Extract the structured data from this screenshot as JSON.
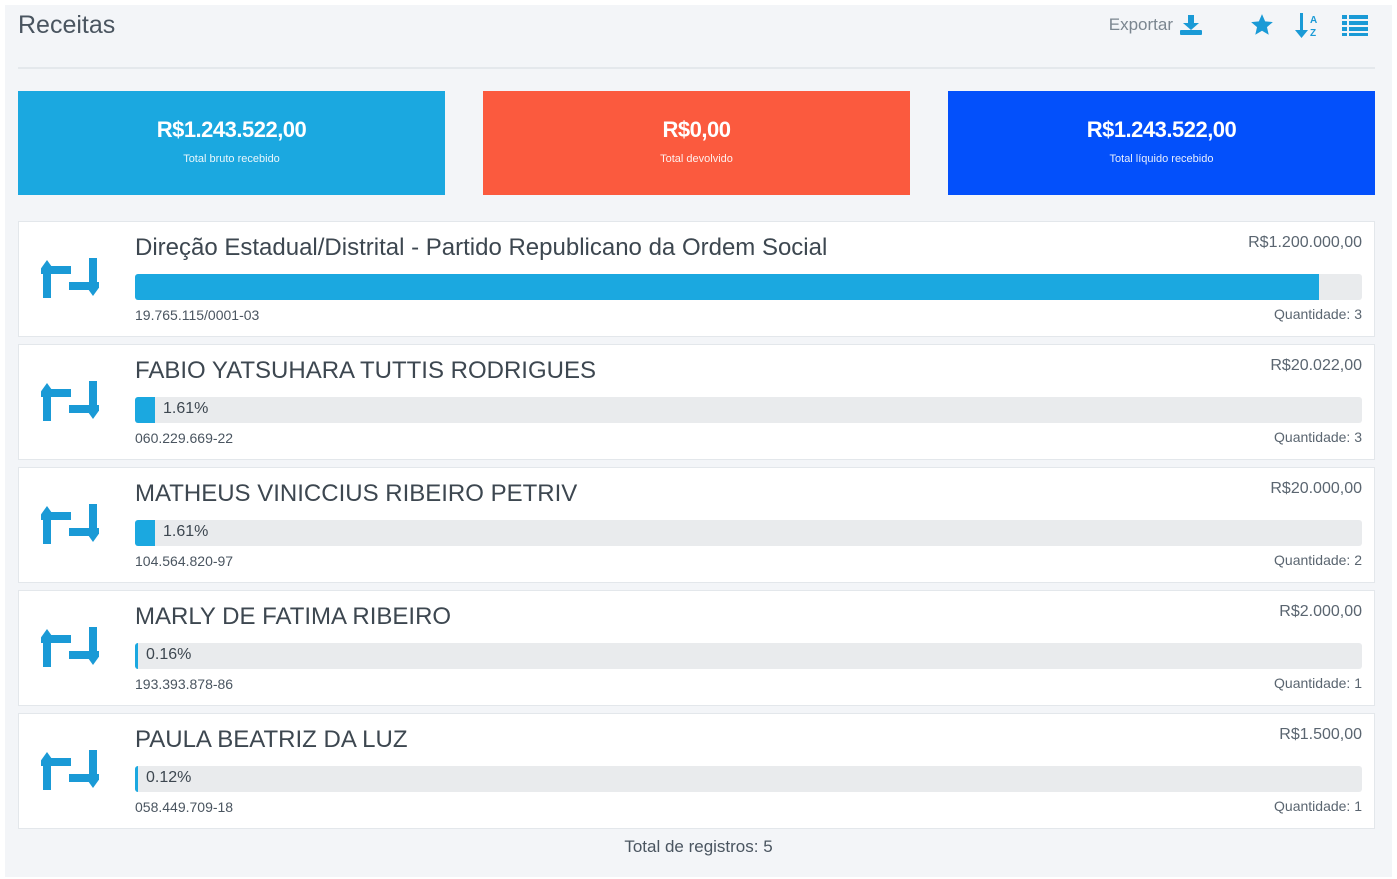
{
  "header": {
    "title": "Receitas",
    "export_label": "Exportar",
    "icons": [
      "download-icon",
      "star-icon",
      "sort-icon",
      "list-icon"
    ]
  },
  "summary": [
    {
      "amount": "R$1.243.522,00",
      "label": "Total bruto recebido",
      "color": "#1ba8e0"
    },
    {
      "amount": "R$0,00",
      "label": "Total devolvido",
      "color": "#fb5a3e"
    },
    {
      "amount": "R$1.243.522,00",
      "label": "Total líquido recebido",
      "color": "#0350fb"
    }
  ],
  "rows": [
    {
      "name": "Direção Estadual/Distrital - Partido Republicano da Ordem Social",
      "value": "R$1.200.000,00",
      "percent": 96.5,
      "percent_label": "",
      "document": "19.765.115/0001-03",
      "quantity": "Quantidade: 3"
    },
    {
      "name": "FABIO YATSUHARA TUTTIS RODRIGUES",
      "value": "R$20.022,00",
      "percent": 1.61,
      "percent_label": "1.61%",
      "document": "060.229.669-22",
      "quantity": "Quantidade: 3"
    },
    {
      "name": "MATHEUS VINICCIUS RIBEIRO PETRIV",
      "value": "R$20.000,00",
      "percent": 1.61,
      "percent_label": "1.61%",
      "document": "104.564.820-97",
      "quantity": "Quantidade: 2"
    },
    {
      "name": "MARLY DE FATIMA RIBEIRO",
      "value": "R$2.000,00",
      "percent": 0.16,
      "percent_label": "0.16%",
      "document": "193.393.878-86",
      "quantity": "Quantidade: 1"
    },
    {
      "name": "PAULA BEATRIZ DA LUZ",
      "value": "R$1.500,00",
      "percent": 0.12,
      "percent_label": "0.12%",
      "document": "058.449.709-18",
      "quantity": "Quantidade: 1"
    }
  ],
  "footer": {
    "total_label": "Total de registros: 5"
  },
  "colors": {
    "accent": "#1ba8e0",
    "icon": "#1a9ad6",
    "track": "#e9ebed"
  }
}
